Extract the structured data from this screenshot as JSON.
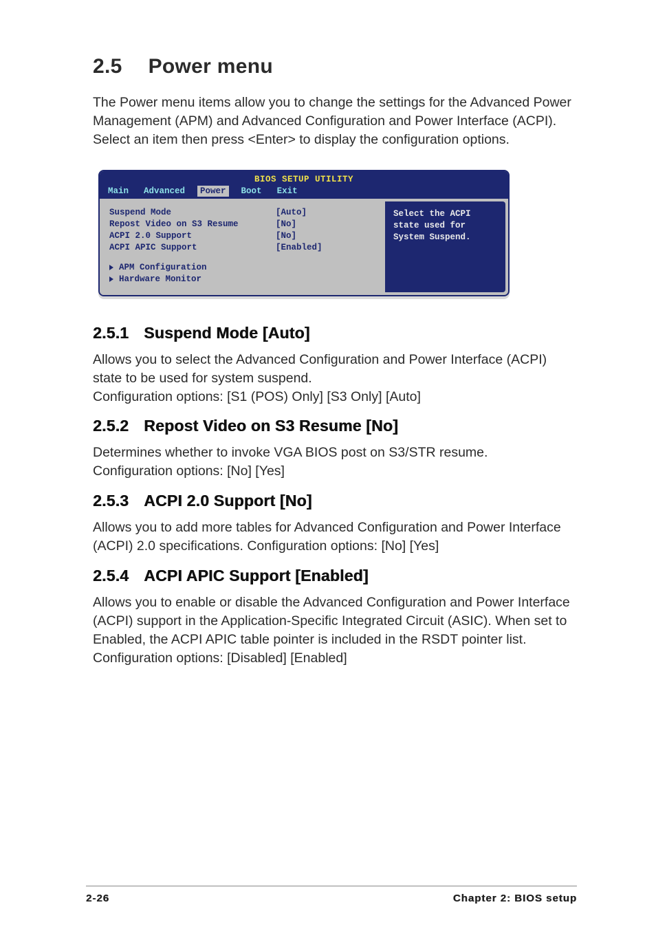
{
  "page": {
    "section_number": "2.5",
    "section_title": "Power menu",
    "intro": "The Power menu items allow you to change the settings for the Advanced Power Management (APM) and Advanced Configuration and Power Interface (ACPI). Select an item then press <Enter> to display the configuration options."
  },
  "bios": {
    "title": "BIOS SETUP UTILITY",
    "tabs": [
      "Main",
      "Advanced",
      "Power",
      "Boot",
      "Exit"
    ],
    "active_tab_index": 2,
    "items": [
      {
        "label": "Suspend Mode",
        "value": "[Auto]"
      },
      {
        "label": "Repost Video on S3 Resume",
        "value": "[No]"
      },
      {
        "label": "ACPI 2.0 Support",
        "value": "[No]"
      },
      {
        "label": "ACPI APIC Support",
        "value": "[Enabled]"
      }
    ],
    "submenus": [
      "APM Configuration",
      "Hardware Monitor"
    ],
    "help": "Select the ACPI state used for System Suspend."
  },
  "sections": [
    {
      "num": "2.5.1",
      "title": "Suspend Mode [Auto]",
      "body": "Allows you to select the Advanced Configuration and Power Interface (ACPI) state to be used for system suspend.\nConfiguration options: [S1 (POS) Only] [S3 Only] [Auto]"
    },
    {
      "num": "2.5.2",
      "title": "Repost Video on S3 Resume [No]",
      "body": "Determines whether to invoke VGA BIOS post on S3/STR resume.\nConfiguration options: [No] [Yes]"
    },
    {
      "num": "2.5.3",
      "title": "ACPI 2.0 Support [No]",
      "body": "Allows you to add more tables for Advanced Configuration and Power Interface (ACPI) 2.0 specifications. Configuration options: [No] [Yes]"
    },
    {
      "num": "2.5.4",
      "title": "ACPI APIC Support [Enabled]",
      "body": "Allows you to enable or disable the Advanced Configuration and Power Interface (ACPI) support in the Application-Specific Integrated Circuit (ASIC). When set to Enabled, the ACPI APIC table pointer is included in the RSDT pointer list. Configuration options: [Disabled] [Enabled]"
    }
  ],
  "footer": {
    "page": "2-26",
    "chapter": "Chapter 2: BIOS setup"
  }
}
